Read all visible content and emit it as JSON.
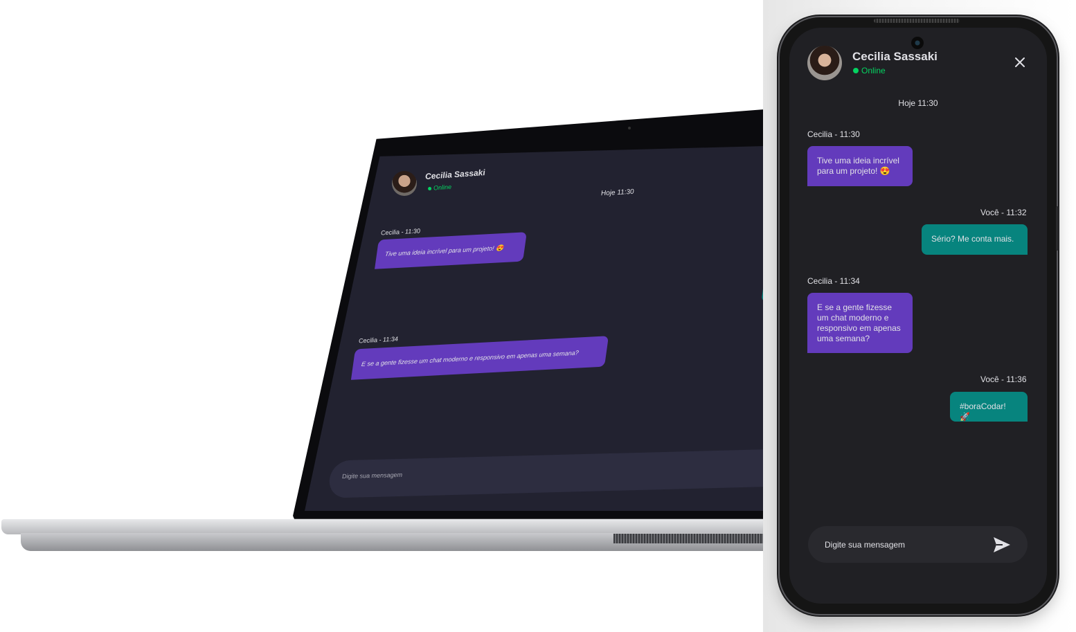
{
  "contact": {
    "name": "Cecilia Sassaki",
    "status": "Online"
  },
  "day_label": "Hoje 11:30",
  "messages": [
    {
      "from": "contact",
      "sender": "Cecilia - 11:30",
      "text": "Tive uma ideia incrível para um projeto! 😍"
    },
    {
      "from": "me",
      "sender": "Você - 11:32",
      "text": "Sério? Me conta mais."
    },
    {
      "from": "contact",
      "sender": "Cecilia - 11:34",
      "text": "E se a gente fizesse um chat moderno e responsivo em apenas uma semana?"
    },
    {
      "from": "me",
      "sender": "Você - 11:36",
      "text": "#boraCodar! 🚀"
    }
  ],
  "input": {
    "placeholder": "Digite sua mensagem"
  },
  "laptop": {
    "contact_name": "Cecilia Sassaki",
    "status": "Online",
    "day_label": "Hoje 11:30",
    "msg1_sender": "Cecilia - 11:30",
    "msg1_text": "Tive uma ideia incrível para um projeto! 😍",
    "msg2_sender": "Cecilia - 11:34",
    "msg2_text": "E se a gente fizesse um chat moderno e responsivo em apenas uma semana?",
    "input_placeholder": "Digite sua mensagem"
  },
  "colors": {
    "background": "#202024",
    "incoming": "#633bbc",
    "outgoing": "#07847e",
    "online": "#04d361",
    "text": "#e1e1e6"
  },
  "icons": {
    "close": "close-icon",
    "send": "send-icon"
  }
}
